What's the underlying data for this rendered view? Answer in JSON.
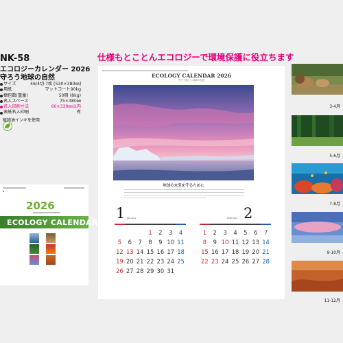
{
  "product": {
    "code": "NK-58",
    "title_line1": "エコロジーカレンダー 2026",
    "title_line2": "守ろう地球の自然",
    "specs": [
      {
        "label": "サイズ",
        "value": "46/4切·7枚 [530×380㎜]",
        "highlight": false
      },
      {
        "label": "用紙",
        "value": "マットコート90kg",
        "highlight": false
      },
      {
        "label": "梱包数(重量)",
        "value": "50冊 (8kg)",
        "highlight": false
      },
      {
        "label": "名入スペース",
        "value": "75×380㎜",
        "highlight": false
      },
      {
        "label": "名入印刷寸法",
        "value": "60×330㎜以内",
        "highlight": true
      },
      {
        "label": "表紙名入印刷",
        "value": "有",
        "highlight": false
      }
    ],
    "ink_note": "植物油インキを使用"
  },
  "cover": {
    "year": "2026",
    "band_text": "ECOLOGY CALENDAR"
  },
  "headline": "仕様もとことんエコロジーで環境保護に役立ちます",
  "calendar": {
    "title": "ECOLOGY CALENDAR 2026",
    "subtitle": "守ろう美しい地球の自然",
    "photo_caption": "地球の未来を守るために",
    "months": [
      {
        "number": "1",
        "name_en": "January",
        "days": [
          "",
          "",
          "",
          "1",
          "2",
          "3",
          "4",
          "5",
          "6",
          "7",
          "8",
          "9",
          "10",
          "11",
          "12",
          "13",
          "14",
          "15",
          "16",
          "17",
          "18",
          "19",
          "20",
          "21",
          "22",
          "23",
          "24",
          "25",
          "26",
          "27",
          "28",
          "29",
          "30",
          "31"
        ]
      },
      {
        "number": "2",
        "name_en": "February",
        "days": [
          "1",
          "2",
          "3",
          "4",
          "5",
          "6",
          "7",
          "8",
          "9",
          "10",
          "11",
          "12",
          "13",
          "14",
          "15",
          "16",
          "17",
          "18",
          "19",
          "20",
          "21",
          "22",
          "23",
          "24",
          "25",
          "26",
          "27",
          "28"
        ]
      }
    ]
  },
  "thumbnails": [
    {
      "label": "3-4月"
    },
    {
      "label": "5-6月"
    },
    {
      "label": "7-8月"
    },
    {
      "label": "9-10月"
    },
    {
      "label": "11-12月"
    }
  ],
  "colors": {
    "accent_pink": "#e5007f",
    "sunday_red": "#c8262c",
    "saturday_blue": "#1d60b0",
    "eco_green": "#6cae2e"
  }
}
